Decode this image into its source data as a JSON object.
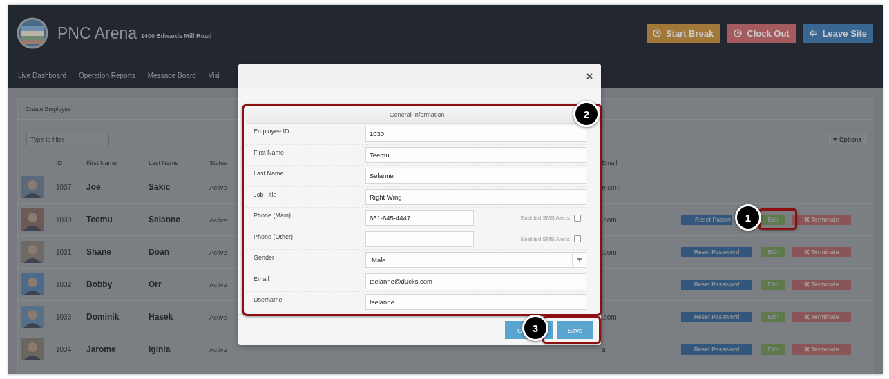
{
  "header": {
    "title": "PNC Arena",
    "address": "1400 Edwards Mill Road",
    "buttons": [
      {
        "label": "Start Break",
        "kind": "break"
      },
      {
        "label": "Clock Out",
        "kind": "clockout"
      },
      {
        "label": "Leave Site",
        "kind": "leave"
      }
    ]
  },
  "nav": [
    "Live Dashboard",
    "Operation Reports",
    "Message Board",
    "Visi"
  ],
  "panel": {
    "tab": "Create Employee",
    "filter_placeholder": "Type to filter",
    "options": "Options"
  },
  "table": {
    "columns": [
      "ID",
      "First Name",
      "Last Name",
      "Status",
      "Email"
    ],
    "rows": [
      {
        "id": "1037",
        "first": "Joe",
        "last": "Sakic",
        "status": "Active",
        "email": "e.com"
      },
      {
        "id": "1030",
        "first": "Teemu",
        "last": "Selanne",
        "status": "Active",
        "email": ".com",
        "reset": "Reset Passw",
        "edit": "Edit",
        "terminate": "Terminate"
      },
      {
        "id": "1031",
        "first": "Shane",
        "last": "Doan",
        "status": "Active",
        "email": ".com",
        "reset": "Reset Password",
        "edit": "Edit",
        "terminate": "Terminate"
      },
      {
        "id": "1032",
        "first": "Bobby",
        "last": "Orr",
        "status": "Active",
        "reset": "Reset Password",
        "edit": "Edit",
        "terminate": "Terminate"
      },
      {
        "id": "1033",
        "first": "Dominik",
        "last": "Hasek",
        "status": "Active",
        "email": ".com",
        "reset": "Reset Password",
        "edit": "Edit",
        "terminate": "Terminate"
      },
      {
        "id": "1034",
        "first": "Jarome",
        "last": "Iginla",
        "status": "Active",
        "email": "a",
        "reset": "Reset Password",
        "edit": "Edit",
        "terminate": "Terminate"
      }
    ]
  },
  "modal": {
    "section": "General Information",
    "fields": [
      {
        "label": "Employee ID",
        "value": "1030",
        "kind": "text"
      },
      {
        "label": "First Name",
        "value": "Teemu",
        "kind": "text"
      },
      {
        "label": "Last Name",
        "value": "Selanne",
        "kind": "text"
      },
      {
        "label": "Job Title",
        "value": "Right Wing",
        "kind": "text"
      },
      {
        "label": "Phone (Main)",
        "value": "661-645-4447",
        "kind": "phone",
        "sms_label": "Enabled SMS Alerts",
        "checked": false
      },
      {
        "label": "Phone (Other)",
        "kind": "phone",
        "sms_label": "Enabled SMS Alerts",
        "checked": false
      },
      {
        "label": "Gender",
        "value": "Male",
        "kind": "select"
      },
      {
        "label": "Email",
        "value": "tselanne@ducks.com",
        "kind": "text"
      },
      {
        "label": "Username",
        "value": "tselanne",
        "kind": "text"
      }
    ],
    "cancel": "C",
    "save": "Save"
  },
  "callouts": [
    "1",
    "2",
    "3"
  ]
}
